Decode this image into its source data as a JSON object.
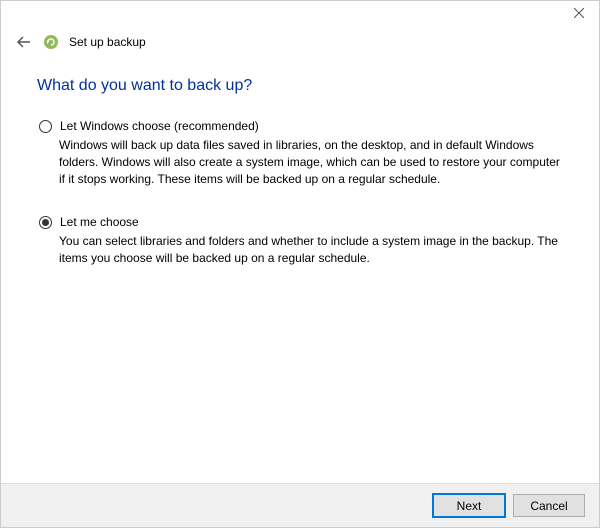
{
  "window": {
    "title": "Set up backup"
  },
  "page": {
    "heading": "What do you want to back up?"
  },
  "options": {
    "windows_choose": {
      "label": "Let Windows choose (recommended)",
      "desc": "Windows will back up data files saved in libraries, on the desktop, and in default Windows folders. Windows will also create a system image, which can be used to restore your computer if it stops working. These items will be backed up on a regular schedule.",
      "selected": false
    },
    "let_me_choose": {
      "label": "Let me choose",
      "desc": "You can select libraries and folders and whether to include a system image in the backup. The items you choose will be backed up on a regular schedule.",
      "selected": true
    }
  },
  "footer": {
    "next": "Next",
    "cancel": "Cancel"
  }
}
